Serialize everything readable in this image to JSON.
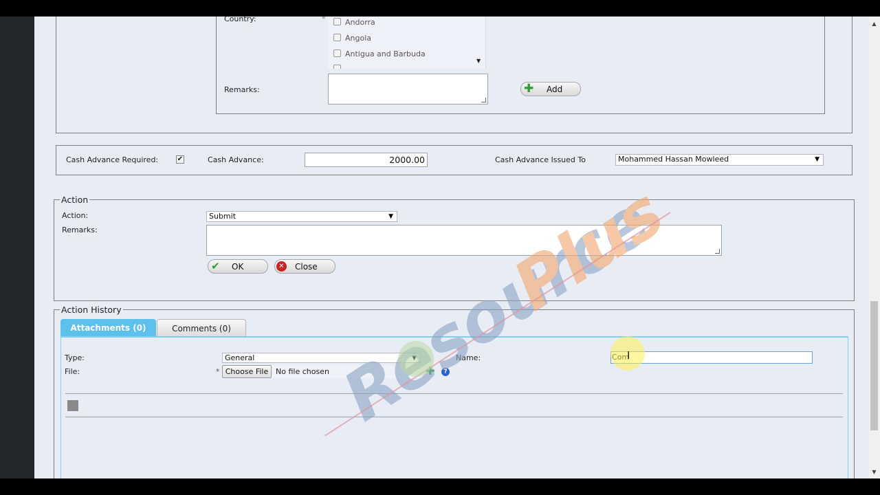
{
  "country_section": {
    "country_label": "Country:",
    "required_mark": "*",
    "countries": [
      "Andorra",
      "Angola",
      "Antigua and Barbuda"
    ],
    "remarks_label": "Remarks:",
    "add_label": "Add"
  },
  "cash_advance": {
    "required_label": "Cash Advance Required:",
    "required_checked": true,
    "amount_label": "Cash Advance:",
    "amount_value": "2000.00",
    "issued_to_label": "Cash Advance Issued To",
    "issued_to_value": "Mohammed Hassan Mowleed"
  },
  "action_section": {
    "legend": "Action",
    "action_label": "Action:",
    "action_value": "Submit",
    "remarks_label": "Remarks:",
    "ok_label": "OK",
    "close_label": "Close"
  },
  "history": {
    "legend": "Action History",
    "tabs": [
      {
        "label": "Attachments (0)",
        "active": true
      },
      {
        "label": "Comments (0)",
        "active": false
      }
    ],
    "type_label": "Type:",
    "type_value": "General",
    "name_label": "Name:",
    "name_value": "Com",
    "file_label": "File:",
    "required_mark": "*",
    "choose_file_label": "Choose File",
    "no_file_label": "No file chosen"
  },
  "watermark": {
    "text": "ResourcePlus"
  },
  "colors": {
    "page_bg": "#e8edf5",
    "tab_active": "#5bc0eb",
    "panel_border": "#7fd0ee",
    "watermark_orange": "#f3a56a",
    "watermark_blue": "#8aa3c4"
  }
}
